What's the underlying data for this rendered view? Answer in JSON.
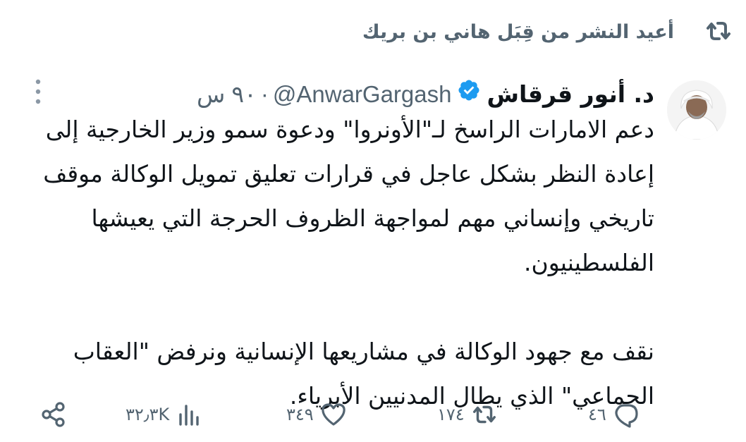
{
  "reposted": {
    "text": "أعيد النشر من قِبَل هاني بن بريك",
    "icon": "repost-icon"
  },
  "tweet": {
    "author_name": "د. أنور قرقاش",
    "verified": true,
    "handle": "@AnwarGargash",
    "separator": "·",
    "time": "٩٠ س",
    "paragraphs": [
      "دعم الامارات الراسخ لـ\"الأونروا\" ودعوة سمو وزير الخارجية إلى إعادة النظر بشكل عاجل في قرارات تعليق تمويل الوكالة موقف تاريخي وإنساني مهم لمواجهة الظروف الحرجة التي يعيشها الفلسطينيون.",
      "نقف مع جهود الوكالة في مشاريعها الإنسانية ونرفض \"العقاب الجماعي\" الذي يطال المدنيين الأبرياء."
    ]
  },
  "actions": {
    "reply_count": "٤٦",
    "retweet_count": "١٧٤",
    "like_count": "٣٤٩",
    "views_count": "٣٢٫٣K"
  },
  "colors": {
    "text": "#0f1419",
    "secondary": "#536471",
    "verified": "#1d9bf0"
  }
}
